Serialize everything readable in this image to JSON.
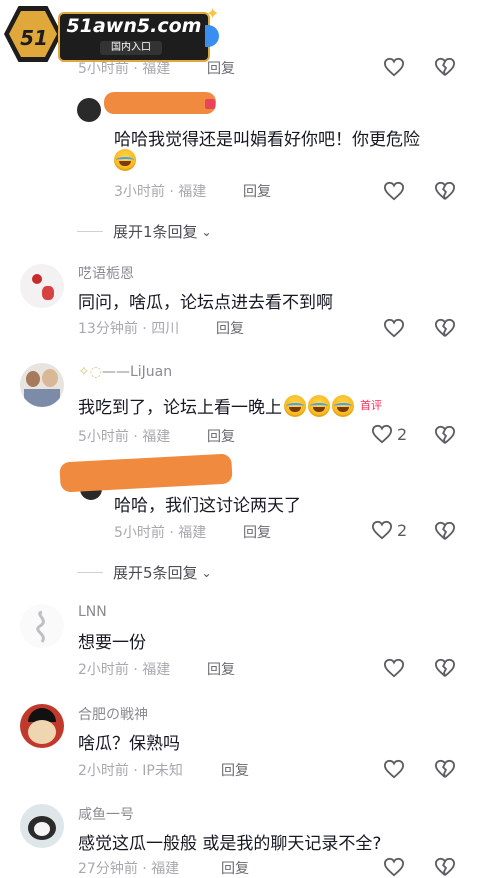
{
  "logo": {
    "badge": "51",
    "site": "51awn5.com",
    "entry": "国内入口"
  },
  "comments": [
    {
      "time": "5小时前",
      "loc": "福建",
      "reply": "回复"
    },
    {
      "text": "哈哈我觉得还是叫娟看好你吧！你更危险",
      "time": "3小时前",
      "loc": "福建",
      "reply": "回复"
    },
    {
      "name": "呓语栀恩",
      "text": "同问，啥瓜，论坛点进去看不到啊",
      "time": "13分钟前",
      "loc": "四川",
      "reply": "回复"
    },
    {
      "name": "——LiJuan",
      "text": "我吃到了，论坛上看一晚上",
      "badge": "首评",
      "time": "5小时前",
      "loc": "福建",
      "reply": "回复",
      "likes": "2"
    },
    {
      "text": "哈哈，我们这讨论两天了",
      "time": "5小时前",
      "loc": "福建",
      "reply": "回复",
      "likes": "2"
    },
    {
      "name": "LNN",
      "text": "想要一份",
      "time": "2小时前",
      "loc": "福建",
      "reply": "回复"
    },
    {
      "name": "合肥の戦神",
      "text": "啥瓜？保熟吗",
      "time": "2小时前",
      "loc": "IP未知",
      "reply": "回复"
    },
    {
      "name": "咸鱼一号",
      "text": "感觉这瓜一般般 或是我的聊天记录不全?",
      "time": "27分钟前",
      "loc": "福建",
      "reply": "回复"
    }
  ],
  "expand": {
    "first": "展开1条回复",
    "second": "展开5条回复"
  }
}
